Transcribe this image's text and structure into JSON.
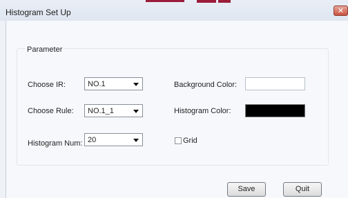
{
  "window": {
    "title": "Histogram Set Up",
    "close_glyph": "✕"
  },
  "group": {
    "label": "Parameter"
  },
  "fields": {
    "choose_ir": {
      "label": "Choose IR:",
      "value": "NO.1"
    },
    "choose_rule": {
      "label": "Choose Rule:",
      "value": "NO.1_1"
    },
    "histogram_num": {
      "label": "Histogram Num:",
      "value": "20"
    },
    "background_color": {
      "label": "Background Color:",
      "color": "#ffffff"
    },
    "histogram_color": {
      "label": "Histogram Color:",
      "color": "#000000"
    },
    "grid": {
      "label": "Grid",
      "checked": false
    }
  },
  "buttons": {
    "save": "Save",
    "quit": "Quit"
  }
}
